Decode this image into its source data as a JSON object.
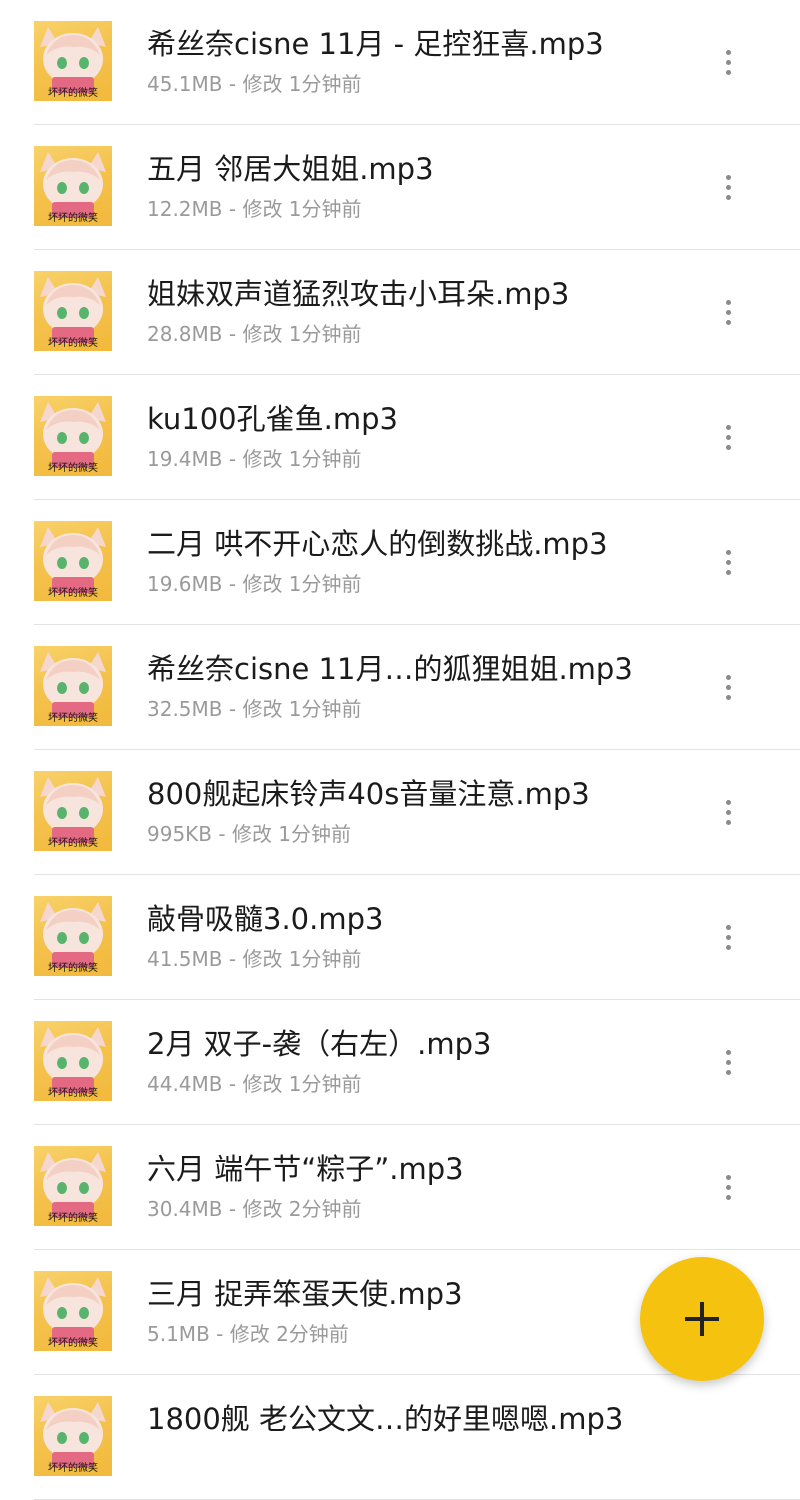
{
  "files": [
    {
      "name": "希丝奈cisne 11月 - 足控狂喜.mp3",
      "meta": "45.1MB - 修改 1分钟前"
    },
    {
      "name": "五月 邻居大姐姐.mp3",
      "meta": "12.2MB - 修改 1分钟前"
    },
    {
      "name": "姐妹双声道猛烈攻击小耳朵.mp3",
      "meta": "28.8MB - 修改 1分钟前"
    },
    {
      "name": "ku100孔雀鱼.mp3",
      "meta": "19.4MB - 修改 1分钟前"
    },
    {
      "name": "二月 哄不开心恋人的倒数挑战.mp3",
      "meta": "19.6MB - 修改 1分钟前"
    },
    {
      "name": "希丝奈cisne 11月…的狐狸姐姐.mp3",
      "meta": "32.5MB - 修改 1分钟前"
    },
    {
      "name": "800舰起床铃声40s音量注意.mp3",
      "meta": "995KB - 修改 1分钟前"
    },
    {
      "name": "敲骨吸髓3.0.mp3",
      "meta": "41.5MB - 修改 1分钟前"
    },
    {
      "name": "2月 双子-袭（右左）.mp3",
      "meta": "44.4MB - 修改 1分钟前"
    },
    {
      "name": "六月 端午节“粽子”.mp3",
      "meta": "30.4MB - 修改 2分钟前"
    },
    {
      "name": "三月 捉弄笨蛋天使.mp3",
      "meta": "5.1MB - 修改 2分钟前"
    },
    {
      "name": "1800舰 老公文文…的好里嗯嗯.mp3",
      "meta": ""
    }
  ],
  "thumbnail": {
    "caption": "坏坏的微笑"
  },
  "fab": {
    "label": "+"
  },
  "colors": {
    "accent": "#f5c20f",
    "title": "#1b1b1b",
    "meta": "#9a9a9a",
    "divider": "#e3e3e3"
  },
  "icons": {
    "row_menu": "more-vert-icon",
    "fab": "plus-icon"
  }
}
